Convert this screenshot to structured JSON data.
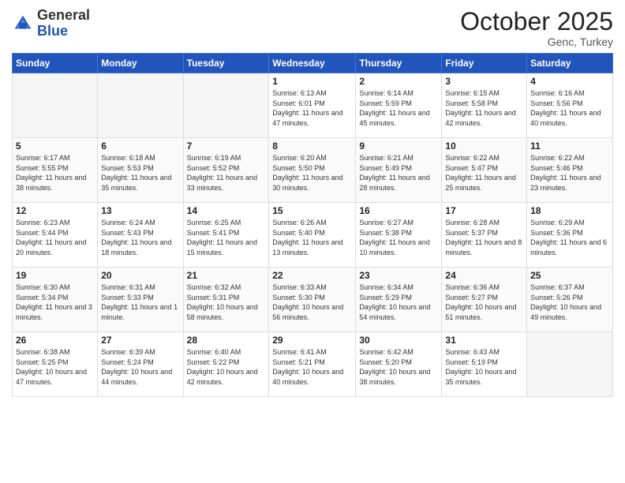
{
  "header": {
    "logo_general": "General",
    "logo_blue": "Blue",
    "month": "October 2025",
    "location": "Genc, Turkey"
  },
  "days_of_week": [
    "Sunday",
    "Monday",
    "Tuesday",
    "Wednesday",
    "Thursday",
    "Friday",
    "Saturday"
  ],
  "weeks": [
    [
      {
        "day": "",
        "info": ""
      },
      {
        "day": "",
        "info": ""
      },
      {
        "day": "",
        "info": ""
      },
      {
        "day": "1",
        "info": "Sunrise: 6:13 AM\nSunset: 6:01 PM\nDaylight: 11 hours and 47 minutes."
      },
      {
        "day": "2",
        "info": "Sunrise: 6:14 AM\nSunset: 5:59 PM\nDaylight: 11 hours and 45 minutes."
      },
      {
        "day": "3",
        "info": "Sunrise: 6:15 AM\nSunset: 5:58 PM\nDaylight: 11 hours and 42 minutes."
      },
      {
        "day": "4",
        "info": "Sunrise: 6:16 AM\nSunset: 5:56 PM\nDaylight: 11 hours and 40 minutes."
      }
    ],
    [
      {
        "day": "5",
        "info": "Sunrise: 6:17 AM\nSunset: 5:55 PM\nDaylight: 11 hours and 38 minutes."
      },
      {
        "day": "6",
        "info": "Sunrise: 6:18 AM\nSunset: 5:53 PM\nDaylight: 11 hours and 35 minutes."
      },
      {
        "day": "7",
        "info": "Sunrise: 6:19 AM\nSunset: 5:52 PM\nDaylight: 11 hours and 33 minutes."
      },
      {
        "day": "8",
        "info": "Sunrise: 6:20 AM\nSunset: 5:50 PM\nDaylight: 11 hours and 30 minutes."
      },
      {
        "day": "9",
        "info": "Sunrise: 6:21 AM\nSunset: 5:49 PM\nDaylight: 11 hours and 28 minutes."
      },
      {
        "day": "10",
        "info": "Sunrise: 6:22 AM\nSunset: 5:47 PM\nDaylight: 11 hours and 25 minutes."
      },
      {
        "day": "11",
        "info": "Sunrise: 6:22 AM\nSunset: 5:46 PM\nDaylight: 11 hours and 23 minutes."
      }
    ],
    [
      {
        "day": "12",
        "info": "Sunrise: 6:23 AM\nSunset: 5:44 PM\nDaylight: 11 hours and 20 minutes."
      },
      {
        "day": "13",
        "info": "Sunrise: 6:24 AM\nSunset: 5:43 PM\nDaylight: 11 hours and 18 minutes."
      },
      {
        "day": "14",
        "info": "Sunrise: 6:25 AM\nSunset: 5:41 PM\nDaylight: 11 hours and 15 minutes."
      },
      {
        "day": "15",
        "info": "Sunrise: 6:26 AM\nSunset: 5:40 PM\nDaylight: 11 hours and 13 minutes."
      },
      {
        "day": "16",
        "info": "Sunrise: 6:27 AM\nSunset: 5:38 PM\nDaylight: 11 hours and 10 minutes."
      },
      {
        "day": "17",
        "info": "Sunrise: 6:28 AM\nSunset: 5:37 PM\nDaylight: 11 hours and 8 minutes."
      },
      {
        "day": "18",
        "info": "Sunrise: 6:29 AM\nSunset: 5:36 PM\nDaylight: 11 hours and 6 minutes."
      }
    ],
    [
      {
        "day": "19",
        "info": "Sunrise: 6:30 AM\nSunset: 5:34 PM\nDaylight: 11 hours and 3 minutes."
      },
      {
        "day": "20",
        "info": "Sunrise: 6:31 AM\nSunset: 5:33 PM\nDaylight: 11 hours and 1 minute."
      },
      {
        "day": "21",
        "info": "Sunrise: 6:32 AM\nSunset: 5:31 PM\nDaylight: 10 hours and 58 minutes."
      },
      {
        "day": "22",
        "info": "Sunrise: 6:33 AM\nSunset: 5:30 PM\nDaylight: 10 hours and 56 minutes."
      },
      {
        "day": "23",
        "info": "Sunrise: 6:34 AM\nSunset: 5:29 PM\nDaylight: 10 hours and 54 minutes."
      },
      {
        "day": "24",
        "info": "Sunrise: 6:36 AM\nSunset: 5:27 PM\nDaylight: 10 hours and 51 minutes."
      },
      {
        "day": "25",
        "info": "Sunrise: 6:37 AM\nSunset: 5:26 PM\nDaylight: 10 hours and 49 minutes."
      }
    ],
    [
      {
        "day": "26",
        "info": "Sunrise: 6:38 AM\nSunset: 5:25 PM\nDaylight: 10 hours and 47 minutes."
      },
      {
        "day": "27",
        "info": "Sunrise: 6:39 AM\nSunset: 5:24 PM\nDaylight: 10 hours and 44 minutes."
      },
      {
        "day": "28",
        "info": "Sunrise: 6:40 AM\nSunset: 5:22 PM\nDaylight: 10 hours and 42 minutes."
      },
      {
        "day": "29",
        "info": "Sunrise: 6:41 AM\nSunset: 5:21 PM\nDaylight: 10 hours and 40 minutes."
      },
      {
        "day": "30",
        "info": "Sunrise: 6:42 AM\nSunset: 5:20 PM\nDaylight: 10 hours and 38 minutes."
      },
      {
        "day": "31",
        "info": "Sunrise: 6:43 AM\nSunset: 5:19 PM\nDaylight: 10 hours and 35 minutes."
      },
      {
        "day": "",
        "info": ""
      }
    ]
  ]
}
